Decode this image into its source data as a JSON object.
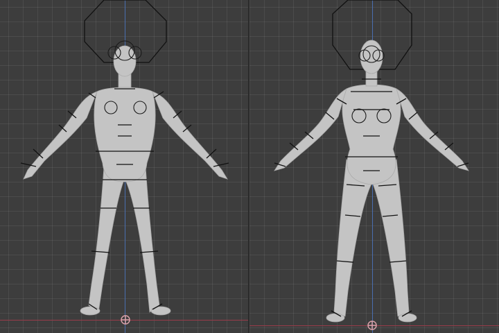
{
  "viewports": [
    {
      "name": "viewport-left",
      "view": "front",
      "model": "male-base-mesh"
    },
    {
      "name": "viewport-right",
      "view": "front",
      "model": "female-base-mesh"
    }
  ],
  "colors": {
    "background": "#3d3d3d",
    "grid": "#525252",
    "z_axis": "#4a6fb0",
    "x_axis": "#9a3b4a",
    "mesh": "#c4c4c4",
    "rig_lines": "#111111",
    "origin_marker": "#d9a0a8"
  },
  "icons": {
    "origin": "origin-marker-icon",
    "head_control": "octagon-head-control-icon"
  }
}
